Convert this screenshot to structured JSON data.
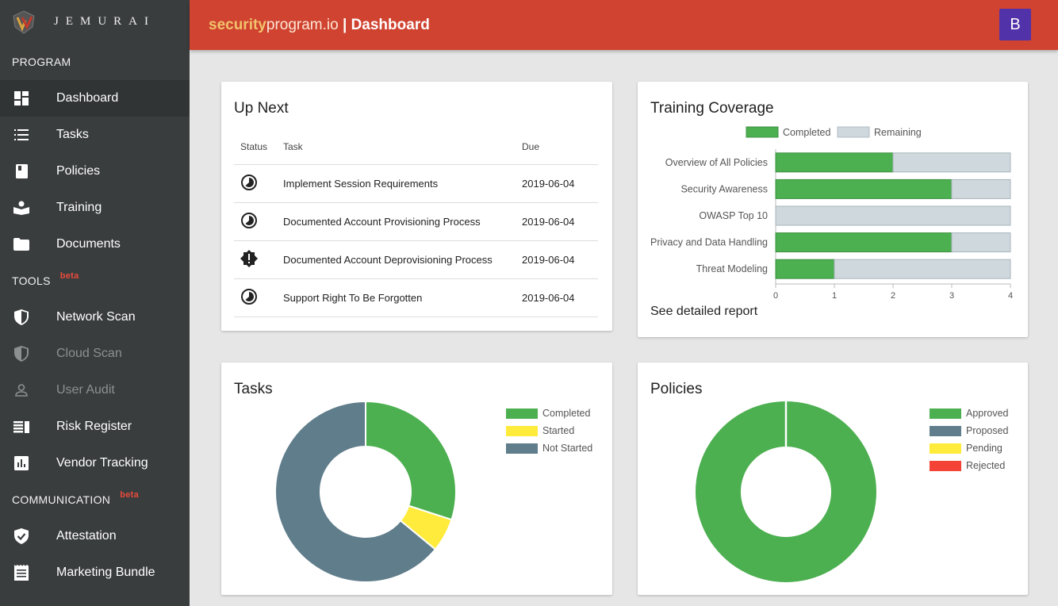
{
  "brand": {
    "name": "JEMURAI"
  },
  "sidebar": {
    "sections": [
      {
        "label": "PROGRAM",
        "beta": ""
      },
      {
        "label": "TOOLS",
        "beta": "beta"
      },
      {
        "label": "COMMUNICATION",
        "beta": "beta"
      }
    ],
    "items": [
      {
        "label": "Dashboard",
        "icon": "dashboard-icon"
      },
      {
        "label": "Tasks",
        "icon": "list-icon"
      },
      {
        "label": "Policies",
        "icon": "book-icon"
      },
      {
        "label": "Training",
        "icon": "reader-icon"
      },
      {
        "label": "Documents",
        "icon": "folder-icon"
      },
      {
        "label": "Network Scan",
        "icon": "shield-icon"
      },
      {
        "label": "Cloud Scan",
        "icon": "shield-icon"
      },
      {
        "label": "User Audit",
        "icon": "person-icon"
      },
      {
        "label": "Risk Register",
        "icon": "register-icon"
      },
      {
        "label": "Vendor Tracking",
        "icon": "chart-icon"
      },
      {
        "label": "Attestation",
        "icon": "verified-shield-icon"
      },
      {
        "label": "Marketing Bundle",
        "icon": "receipt-icon"
      }
    ]
  },
  "header": {
    "title_part1": "security",
    "title_part2": "program.io",
    "title_part3": " | Dashboard",
    "avatar": "B"
  },
  "upnext": {
    "title": "Up Next",
    "columns": [
      "Status",
      "Task",
      "Due"
    ],
    "rows": [
      {
        "status": "in-progress-icon",
        "task": "Implement Session Requirements",
        "due": "2019-06-04"
      },
      {
        "status": "in-progress-icon",
        "task": "Documented Account Provisioning Process",
        "due": "2019-06-04"
      },
      {
        "status": "alert-badge-icon",
        "task": "Documented Account Deprovisioning Process",
        "due": "2019-06-04"
      },
      {
        "status": "in-progress-icon",
        "task": "Support Right To Be Forgotten",
        "due": "2019-06-04"
      }
    ]
  },
  "training": {
    "title": "Training Coverage",
    "link": "See detailed report"
  },
  "tasks": {
    "title": "Tasks"
  },
  "policies": {
    "title": "Policies"
  },
  "colors": {
    "green": "#4caf50",
    "remaining": "#cfd8dc",
    "yellow": "#ffeb3b",
    "slate": "#607d8b",
    "red": "#f44336",
    "header": "#cf4330",
    "avatar": "#5232a8"
  },
  "chart_data": [
    {
      "type": "bar",
      "orientation": "horizontal",
      "stacked": true,
      "categories": [
        "Overview of All Policies",
        "Security Awareness",
        "OWASP Top 10",
        "Privacy and Data Handling",
        "Threat Modeling"
      ],
      "series": [
        {
          "name": "Completed",
          "values": [
            2,
            3,
            0,
            3,
            1
          ],
          "color": "#4caf50"
        },
        {
          "name": "Remaining",
          "values": [
            2,
            1,
            4,
            1,
            3
          ],
          "color": "#cfd8dc"
        }
      ],
      "xlim": [
        0,
        4
      ],
      "xticks": [
        "0",
        "1",
        "2",
        "3",
        "4"
      ],
      "legend": "top"
    },
    {
      "type": "pie",
      "donut": true,
      "labels": [
        "Completed",
        "Started",
        "Not Started"
      ],
      "values": [
        30,
        6,
        64
      ],
      "colors": [
        "#4caf50",
        "#ffeb3b",
        "#607d8b"
      ],
      "legend": "top-right"
    },
    {
      "type": "pie",
      "donut": true,
      "labels": [
        "Approved",
        "Proposed",
        "Pending",
        "Rejected"
      ],
      "values": [
        100,
        0,
        0,
        0
      ],
      "colors": [
        "#4caf50",
        "#607d8b",
        "#ffeb3b",
        "#f44336"
      ],
      "legend": "top-right"
    }
  ]
}
